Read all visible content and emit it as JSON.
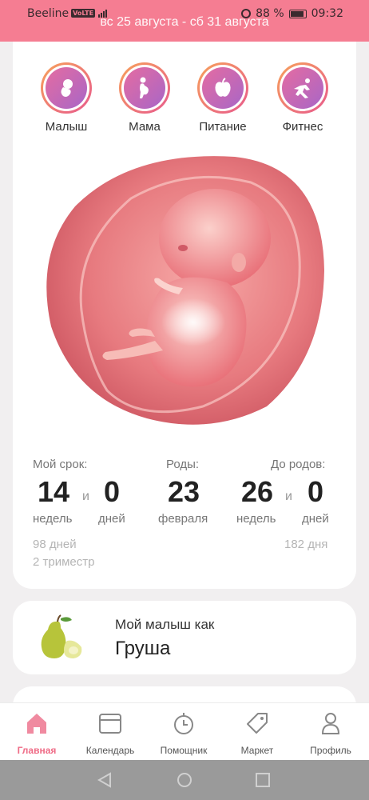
{
  "status_bar": {
    "carrier": "Beeline",
    "volte": "VoLTE",
    "battery": "88 %",
    "time": "09:32"
  },
  "header": {
    "week_range": "вс 25 августа - сб 31 августа"
  },
  "categories": [
    {
      "label": "Малыш",
      "icon": "baby-icon"
    },
    {
      "label": "Мама",
      "icon": "pregnant-mother-icon"
    },
    {
      "label": "Питание",
      "icon": "apple-icon"
    },
    {
      "label": "Фитнес",
      "icon": "fitness-icon"
    }
  ],
  "term": {
    "label": "Мой срок:",
    "weeks": "14",
    "weeks_unit": "недель",
    "conj": "и",
    "days": "0",
    "days_unit": "дней",
    "total_days": "98 дней",
    "trimester": "2 триместр"
  },
  "due": {
    "label": "Роды:",
    "day": "23",
    "month": "февраля"
  },
  "remaining": {
    "label": "До родов:",
    "weeks": "26",
    "weeks_unit": "недель",
    "conj": "и",
    "days": "0",
    "days_unit": "дней",
    "total_days": "182 дня"
  },
  "fruit": {
    "label": "Мой малыш как",
    "name": "Груша",
    "icon": "pear-icon"
  },
  "tabs": [
    {
      "label": "Главная",
      "icon": "home-icon",
      "active": true
    },
    {
      "label": "Календарь",
      "icon": "calendar-icon",
      "active": false
    },
    {
      "label": "Помощник",
      "icon": "timer-icon",
      "active": false
    },
    {
      "label": "Маркет",
      "icon": "tag-icon",
      "active": false
    },
    {
      "label": "Профиль",
      "icon": "profile-icon",
      "active": false
    }
  ],
  "colors": {
    "accent": "#f57d92",
    "active_tab": "#ef6b86",
    "category_gradient": [
      "#e56ca1",
      "#a866c7"
    ]
  }
}
